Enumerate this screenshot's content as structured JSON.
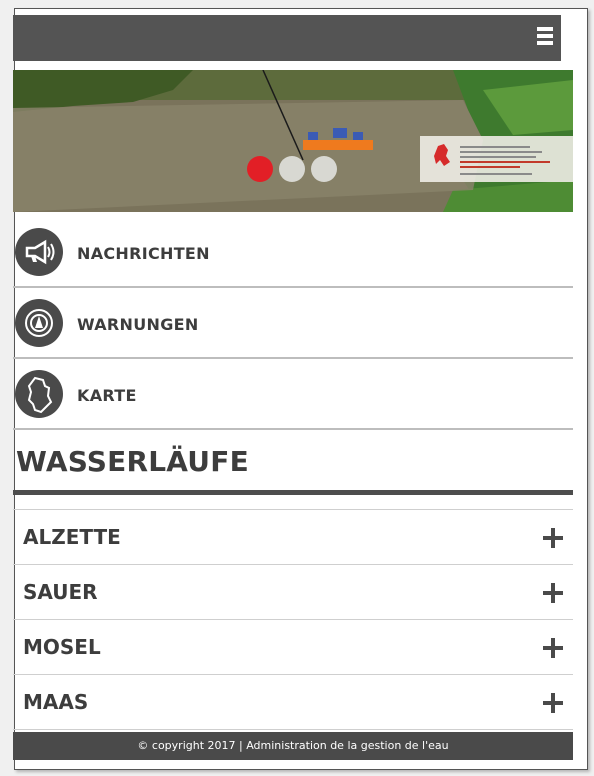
{
  "header": {
    "menu_icon": "hamburger-menu-icon"
  },
  "hero": {
    "slides": [
      {
        "active": true
      },
      {
        "active": false
      },
      {
        "active": false
      }
    ],
    "accent_color": "#e21f26"
  },
  "nav": {
    "items": [
      {
        "label": "NACHRICHTEN",
        "icon": "megaphone-icon"
      },
      {
        "label": "WARNUNGEN",
        "icon": "alarm-icon"
      },
      {
        "label": "KARTE",
        "icon": "map-outline-icon"
      }
    ]
  },
  "section": {
    "title": "WASSERLÄUFE"
  },
  "rivers": [
    {
      "label": "ALZETTE",
      "icon": "plus-icon"
    },
    {
      "label": "SAUER",
      "icon": "plus-icon"
    },
    {
      "label": "MOSEL",
      "icon": "plus-icon"
    },
    {
      "label": "MAAS",
      "icon": "plus-icon"
    }
  ],
  "footer": {
    "text": "© copyright 2017 | Administration de la gestion de l'eau"
  },
  "colors": {
    "dark": "#4a4a4a",
    "divider": "#bdbdbd",
    "text": "#3d3d3d"
  }
}
